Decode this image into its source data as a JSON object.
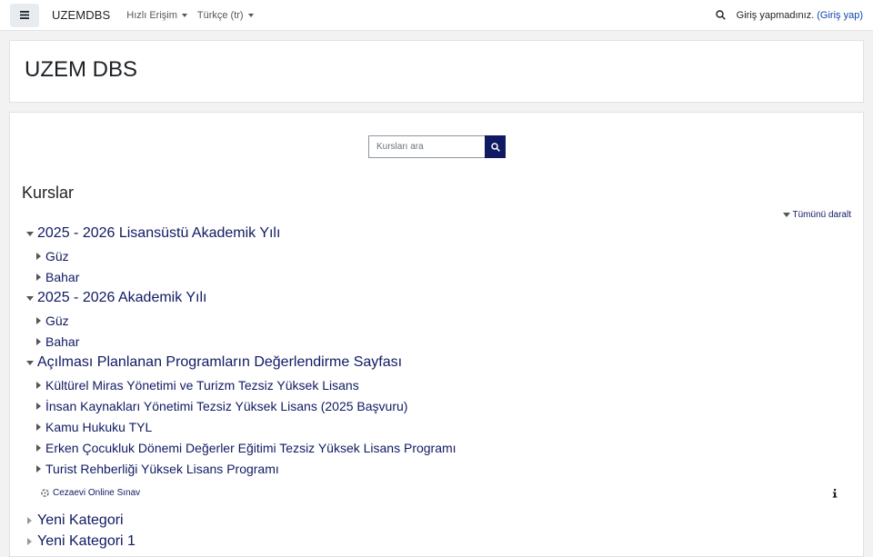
{
  "navbar": {
    "brand": "UZEMDBS",
    "quick_access": "Hızlı Erişim",
    "language": "Türkçe (tr)",
    "not_logged_in": "Giriş yapmadınız.",
    "login_link": "(Giriş yap)"
  },
  "header": {
    "title": "UZEM DBS"
  },
  "search": {
    "placeholder": "Kursları ara"
  },
  "courses": {
    "heading": "Kurslar",
    "collapse_all": "Tümünü daralt",
    "categories": [
      {
        "name": "2025 - 2026 Lisansüstü Akademik Yılı",
        "subs": [
          "Güz",
          "Bahar"
        ]
      },
      {
        "name": "2025 - 2026 Akademik Yılı",
        "subs": [
          "Güz",
          "Bahar"
        ]
      },
      {
        "name": "Açılması Planlanan Programların Değerlendirme Sayfası",
        "subs": [
          "Kültürel Miras Yönetimi ve Turizm Tezsiz Yüksek Lisans",
          "İnsan Kaynakları Yönetimi Tezsiz Yüksek Lisans (2025 Başvuru)",
          "Kamu Hukuku TYL",
          "Erken Çocukluk Dönemi Değerler Eğitimi Tezsiz Yüksek Lisans Programı",
          "Turist Rehberliği Yüksek Lisans Programı"
        ]
      }
    ],
    "course_link": "Cezaevi Online Sınav",
    "more_categories": [
      "Yeni Kategori",
      "Yeni Kategori 1"
    ]
  },
  "colors": {
    "link": "#101a63",
    "search_button": "#101a63",
    "login_link": "#0f47ad"
  }
}
